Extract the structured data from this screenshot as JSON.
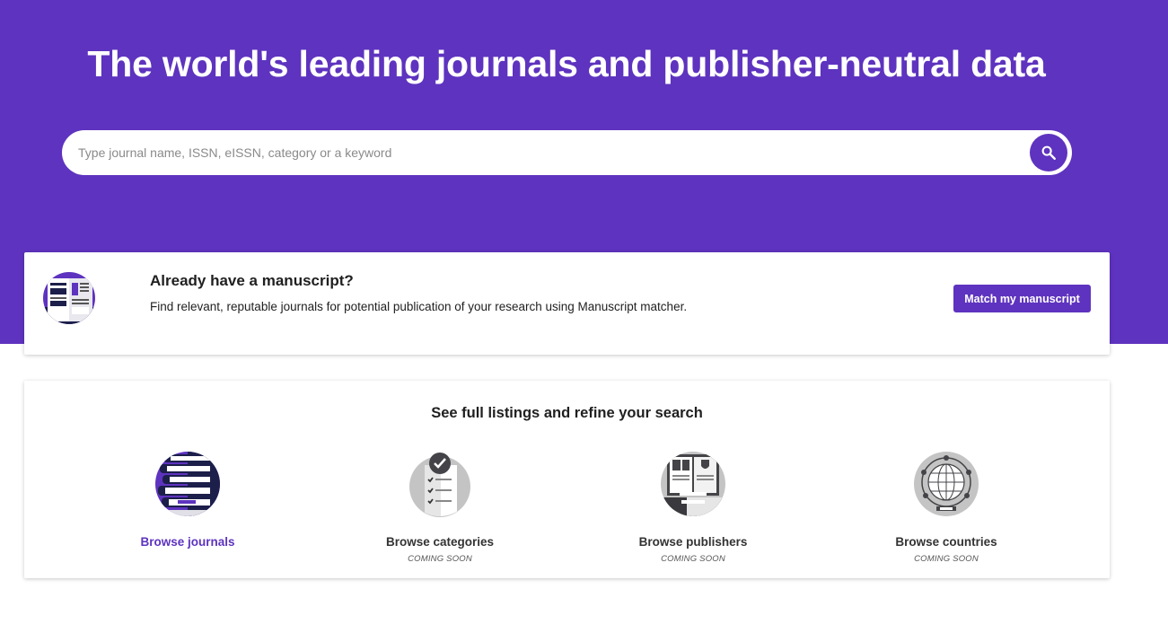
{
  "hero": {
    "title": "The world's leading journals and publisher-neutral data",
    "background_color": "#5e33bf"
  },
  "search": {
    "placeholder": "Type journal name, ISSN, eISSN, category or a keyword",
    "value": "",
    "button_icon": "search-icon"
  },
  "manuscript": {
    "heading": "Already have a manuscript?",
    "description": "Find relevant, reputable journals for potential publication of your research using Manuscript matcher.",
    "button_label": "Match my manuscript",
    "illustration_icon": "manuscript-document-icon"
  },
  "browse": {
    "heading": "See full listings and refine your search",
    "items": [
      {
        "label": "Browse journals",
        "status": "",
        "icon": "journals-stack-icon",
        "active": true
      },
      {
        "label": "Browse categories",
        "status": "COMING SOON",
        "icon": "categories-checklist-icon",
        "active": false
      },
      {
        "label": "Browse publishers",
        "status": "COMING SOON",
        "icon": "publishers-book-icon",
        "active": false
      },
      {
        "label": "Browse countries",
        "status": "COMING SOON",
        "icon": "countries-globe-icon",
        "active": false
      }
    ]
  },
  "colors": {
    "accent": "#5e33bf",
    "text_dark": "#1f1f1f",
    "text_muted": "#555555"
  }
}
